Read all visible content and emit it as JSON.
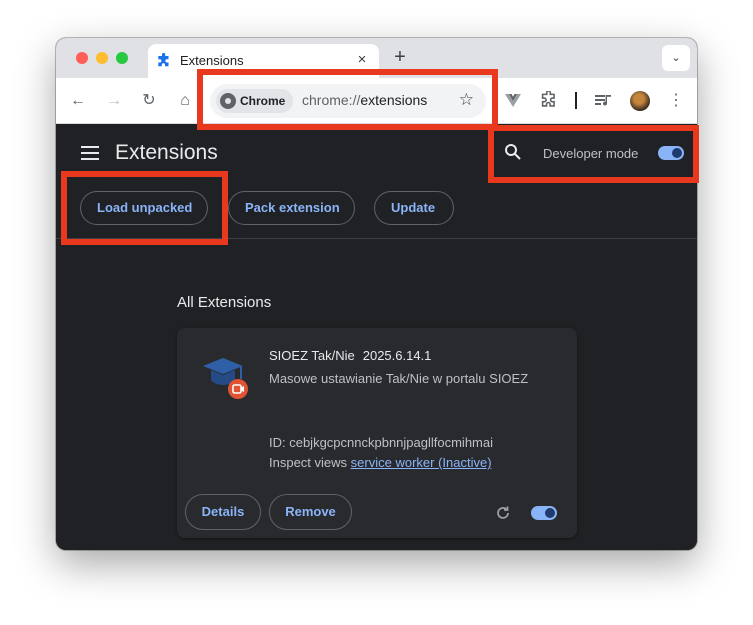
{
  "tab": {
    "title": "Extensions",
    "close": "×",
    "new_tab": "+",
    "tab_search": "⌄"
  },
  "toolbar": {
    "back": "←",
    "forward": "→",
    "reload": "↻",
    "home": "⌂",
    "chip_label": "Chrome",
    "url_scheme": "chrome://",
    "url_path": "extensions",
    "bookmark": "☆",
    "menu": "⋮"
  },
  "page": {
    "title": "Extensions",
    "developer_mode_label": "Developer mode",
    "developer_mode_on": true,
    "buttons": {
      "load_unpacked": "Load unpacked",
      "pack_extension": "Pack extension",
      "update": "Update"
    },
    "section_title": "All Extensions"
  },
  "extension": {
    "name": "SIOEZ Tak/Nie",
    "version": "2025.6.14.1",
    "description": "Masowe ustawianie Tak/Nie w portalu SIOEZ",
    "id_label": "ID: cebjkgcpcnnckpbnnjpagllfocmihmai",
    "inspect_label": "Inspect views",
    "inspect_link": "service worker (Inactive)",
    "details_button": "Details",
    "remove_button": "Remove",
    "enabled": true
  },
  "colors": {
    "highlight": "#e8391f",
    "accent": "#8ab4f8",
    "page_bg": "#202124",
    "card_bg": "#292a2d"
  }
}
